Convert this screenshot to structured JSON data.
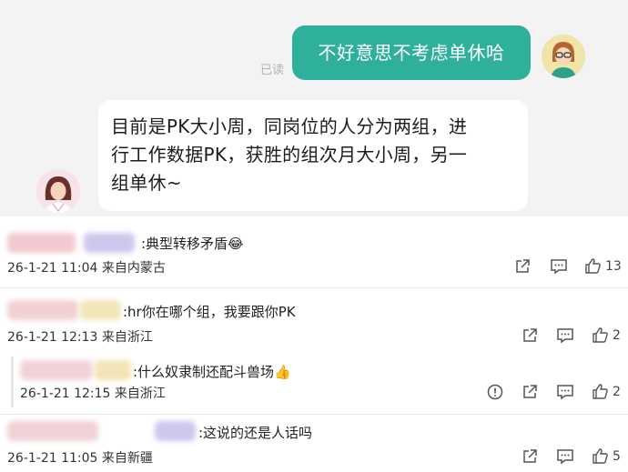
{
  "chat": {
    "outgoing_message": "不好意思不考虑单休哈",
    "read_status": "已读",
    "incoming_message_lines": [
      "目前是PK大小周，同岗位的人分为两组，进",
      "行工作数据PK，获胜的组次月大小周，另一",
      "组单休~"
    ]
  },
  "comments": [
    {
      "text": ":典型转移矛盾😂",
      "date": "26-1-21 11:04",
      "location": "来自内蒙古",
      "likes": "13"
    },
    {
      "text": ":hr你在哪个组，我要跟你PK",
      "date": "26-1-21 12:13",
      "location": "来自浙江",
      "likes": "2"
    },
    {
      "text": ":什么奴隶制还配斗兽场👍",
      "date": "26-1-21 12:15",
      "location": "来自浙江",
      "likes": "2"
    },
    {
      "text": ":这说的还是人话吗",
      "date": "26-1-21 11:05",
      "location": "来自新疆",
      "likes": "5"
    }
  ],
  "colors": {
    "outgoing_bubble": "#2fb09b",
    "chat_background": "#f3f3f3"
  },
  "icons": [
    "share-icon",
    "comment-icon",
    "like-icon",
    "report-icon"
  ]
}
